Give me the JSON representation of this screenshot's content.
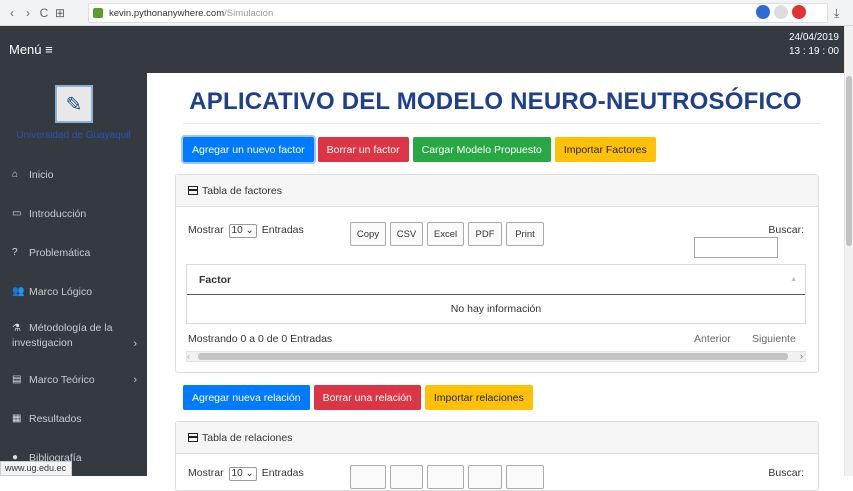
{
  "browser": {
    "back": "‹",
    "forward": "›",
    "reload": "C",
    "apps": "⊞",
    "url_host": "kevin.pythonanywhere.com",
    "url_path": "/Simulacion",
    "download": "⤓"
  },
  "topbar": {
    "menu_label": "Menú ≡",
    "date": "24/04/2019",
    "time": "13 : 19 : 00"
  },
  "sidebar": {
    "university": "Universidad de Guayaquil",
    "items": [
      {
        "icon": "home-icon",
        "glyph": "⌂",
        "label": "Inicio"
      },
      {
        "icon": "presentation-icon",
        "glyph": "▭",
        "label": "Introducción"
      },
      {
        "icon": "question-icon",
        "glyph": "?",
        "label": "Problemática"
      },
      {
        "icon": "users-icon",
        "glyph": "👥",
        "label": "Marco Lógico"
      },
      {
        "icon": "flask-icon",
        "glyph": "⚗",
        "label": "Métodología de la",
        "label2": "investigacion",
        "arrow": "›"
      },
      {
        "icon": "book-icon",
        "glyph": "▤",
        "label": "Marco Teórico",
        "arrow": "›"
      },
      {
        "icon": "chart-icon",
        "glyph": "▦",
        "label": "Resultados"
      },
      {
        "icon": "globe-icon",
        "glyph": "●",
        "label": "Bibliografía"
      }
    ]
  },
  "status_url": "www.ug.edu.ec",
  "main": {
    "title": "APLICATIVO DEL MODELO NEURO-NEUTROSÓFICO",
    "factor_buttons": {
      "add": "Agregar un nuevo factor",
      "delete": "Borrar un factor",
      "load": "Cargar Modelo Propuesto",
      "import": "Importar Factores"
    },
    "factors_card": {
      "header": "Tabla de factores",
      "show": "Mostrar",
      "entries_value": "10",
      "entries": "Entradas",
      "export": [
        "Copy",
        "CSV",
        "Excel",
        "PDF",
        "Print"
      ],
      "search_label": "Buscar:",
      "search_value": "",
      "column": "Factor",
      "empty": "No hay información",
      "info": "Mostrando 0 a 0 de 0 Entradas",
      "prev": "Anterior",
      "next": "Siguiente"
    },
    "relation_buttons": {
      "add": "Agregar nueva relación",
      "delete": "Borrar una relación",
      "import": "Importar relaciones"
    },
    "relations_card": {
      "header": "Tabla de relaciones",
      "show": "Mostrar",
      "entries_value": "10",
      "entries": "Entradas",
      "search_label": "Buscar:"
    }
  },
  "colors": {
    "sidebar_bg": "#343a40",
    "title_blue": "#1e3f8c",
    "primary": "#007bff",
    "danger": "#dc3545",
    "success": "#28a745",
    "warning": "#ffc107"
  }
}
